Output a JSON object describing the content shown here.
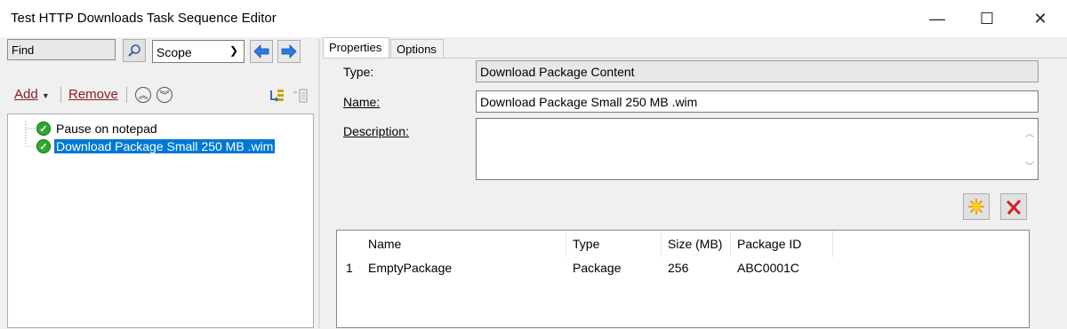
{
  "window": {
    "title": "Test HTTP Downloads Task Sequence Editor",
    "minimize": "—",
    "maximize": "☐",
    "close": "✕"
  },
  "left": {
    "find_label": "Find",
    "scope_value": "Scope",
    "toolbar": {
      "add": "Add",
      "remove": "Remove"
    },
    "tree": [
      {
        "label": "Pause on notepad",
        "status_icon": "green-check-icon",
        "selected": false
      },
      {
        "label": "Download Package Small 250 MB .wim",
        "status_icon": "green-check-icon",
        "selected": true
      }
    ]
  },
  "right": {
    "tabs": [
      "Properties",
      "Options"
    ],
    "active_tab": "Properties",
    "type_label": "Type:",
    "type_value": "Download Package Content",
    "name_label": "Name:",
    "name_value": "Download Package Small 250 MB .wim",
    "description_label": "Description:",
    "description_value": "",
    "grid": {
      "columns": [
        "Name",
        "Type",
        "Size (MB)",
        "Package ID"
      ],
      "rows": [
        {
          "index": "1",
          "name": "EmptyPackage",
          "type": "Package",
          "size": "256",
          "package_id": "ABC0001C"
        }
      ]
    }
  },
  "colors": {
    "selection": "#0078d7",
    "link": "#8b1a1a",
    "check": "#2ea82e"
  }
}
